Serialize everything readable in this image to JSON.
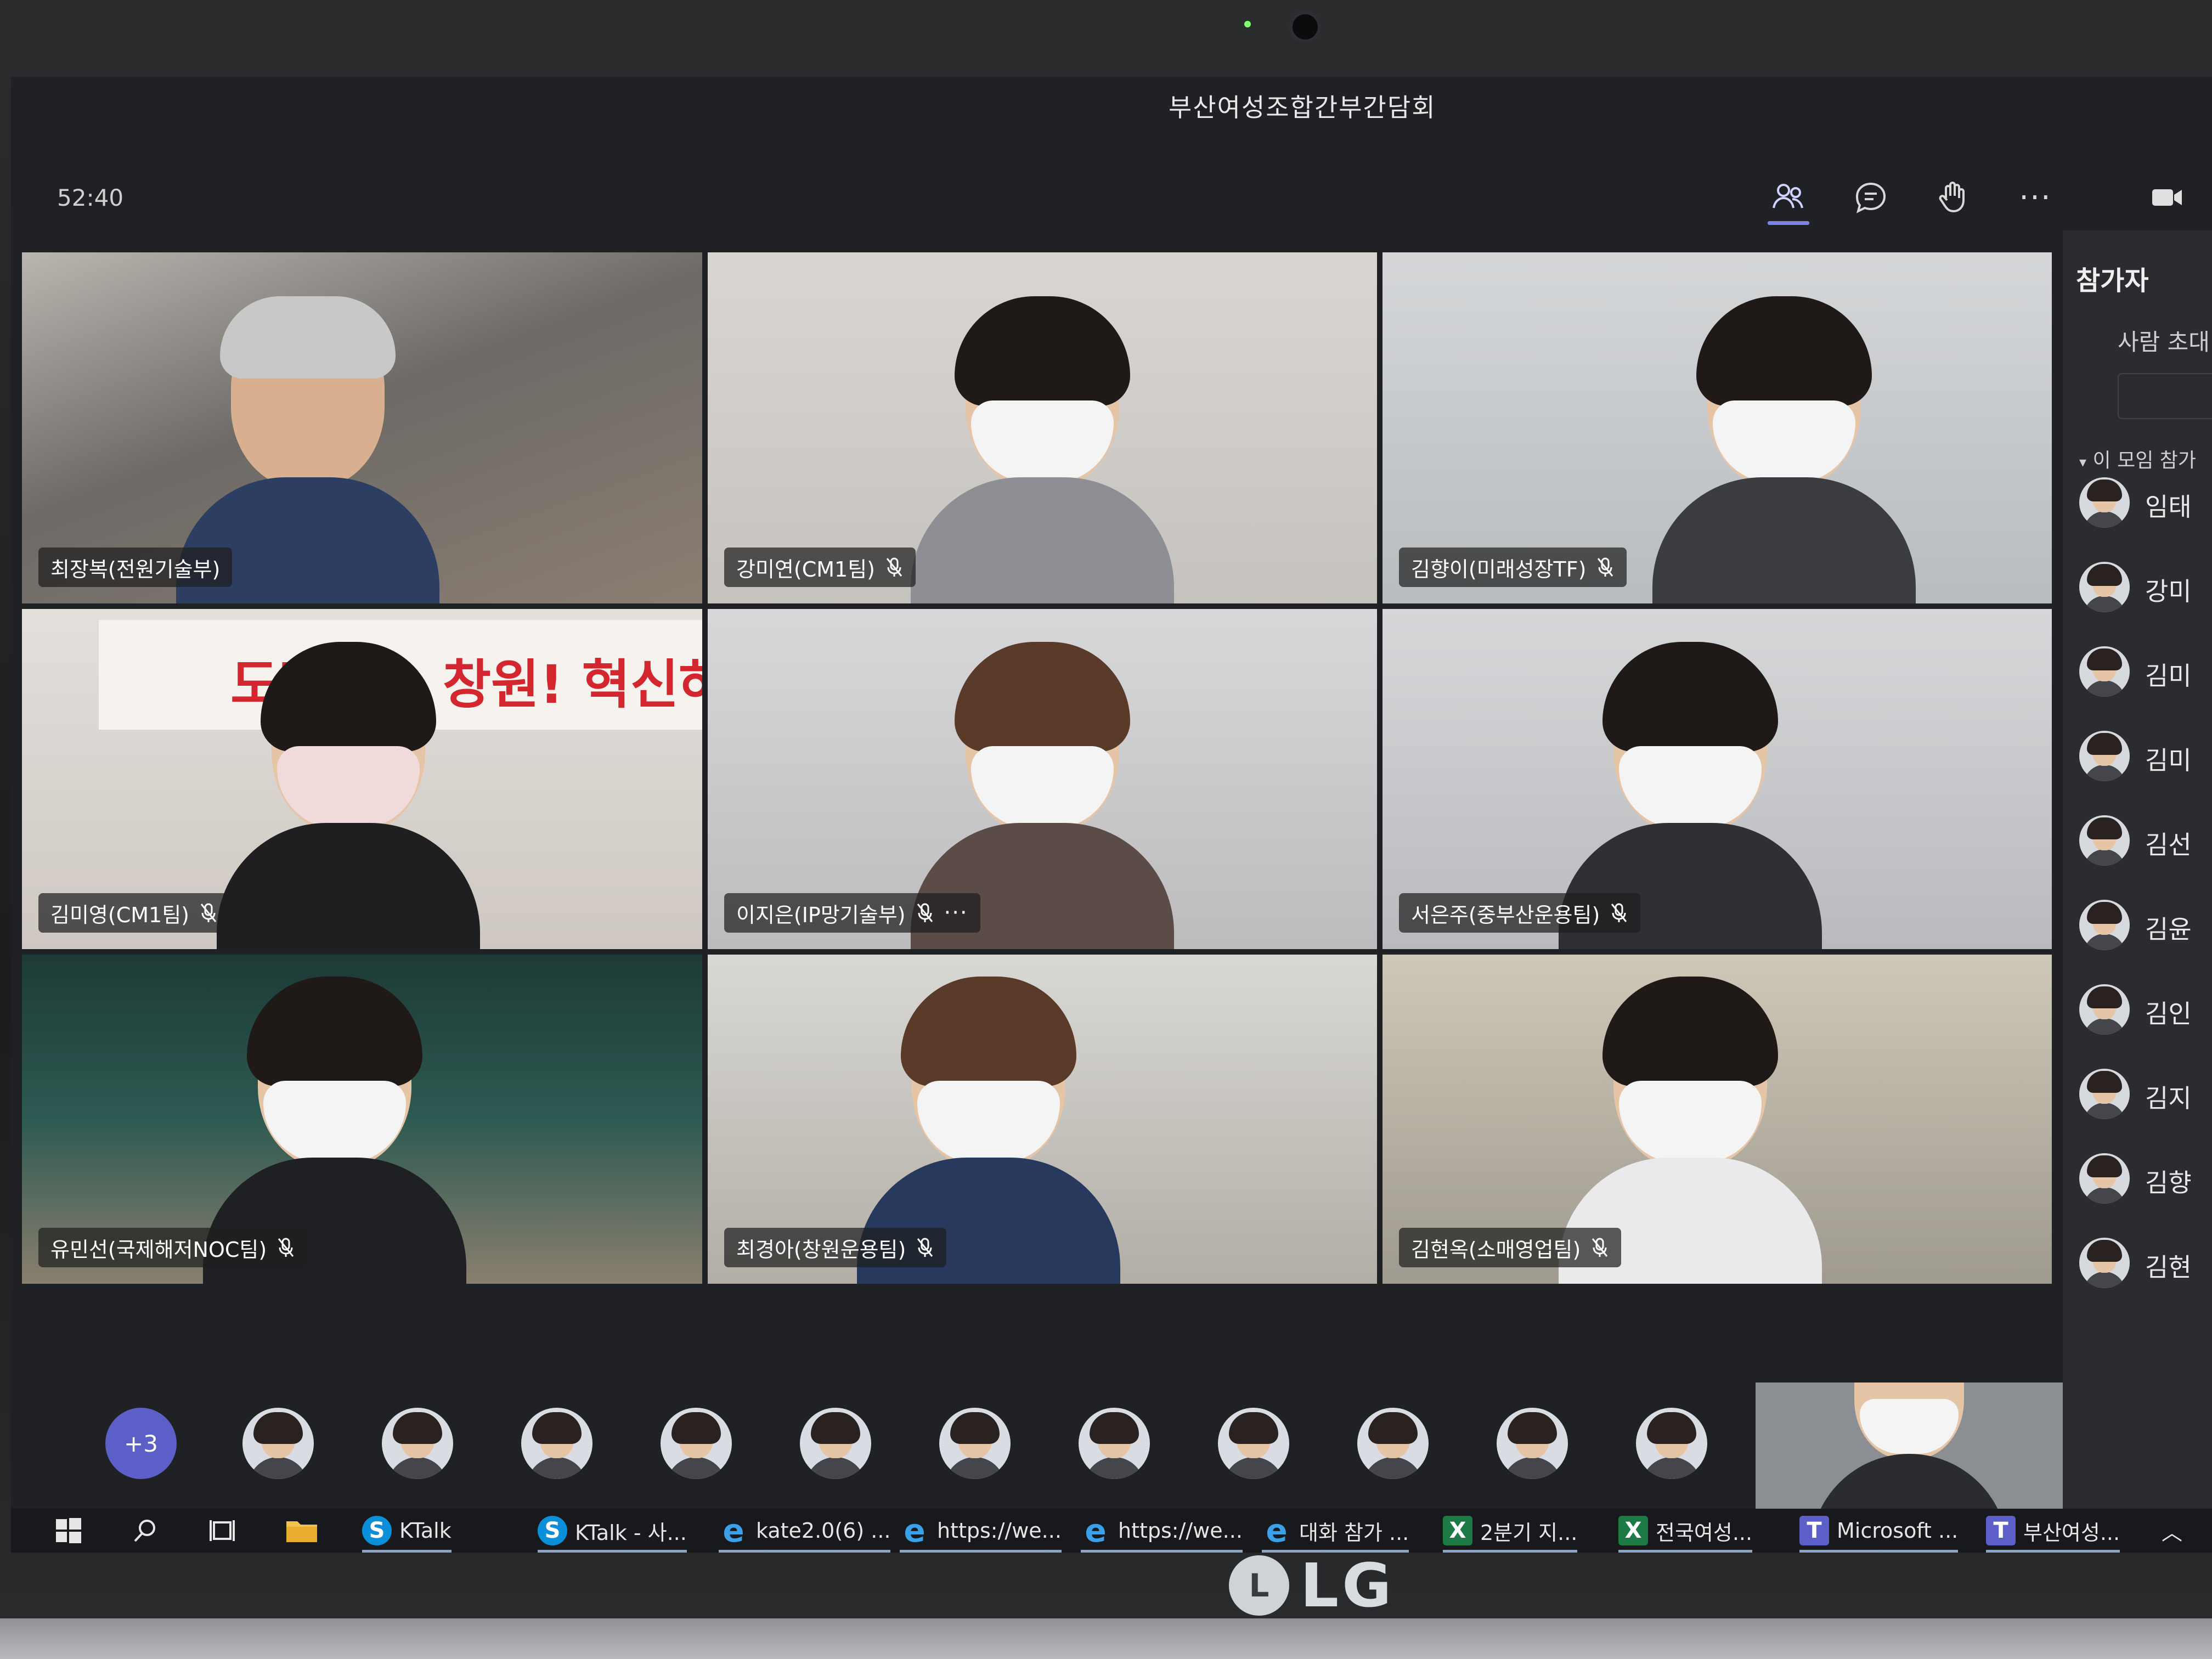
{
  "meeting": {
    "title": "부산여성조합간부간담회",
    "elapsed_time": "52:40"
  },
  "toolbar": {
    "icons": [
      "participants-icon",
      "chat-icon",
      "raise-hand-icon",
      "more-icon",
      "camera-icon"
    ],
    "more_label": "···"
  },
  "tiles": [
    {
      "name": "최장복(전원기술부)",
      "muted": false
    },
    {
      "name": "강미연(CM1팀)",
      "muted": true
    },
    {
      "name": "김향이(미래성장TF)",
      "muted": true
    },
    {
      "name": "김미영(CM1팀)",
      "muted": true,
      "banner": "도전하는 창원! 혁신하라"
    },
    {
      "name": "이지은(IP망기술부)",
      "muted": true,
      "more": "···"
    },
    {
      "name": "서은주(중부산운용팀)",
      "muted": true
    },
    {
      "name": "유민선(국제해저NOC팀)",
      "muted": true
    },
    {
      "name": "최경아(창원운용팀)",
      "muted": true
    },
    {
      "name": "김현옥(소매영업팀)",
      "muted": true
    }
  ],
  "strip": {
    "overflow_count": "+3",
    "avatars": 11
  },
  "participants_panel": {
    "title": "참가자",
    "invite_label": "사람 초대",
    "section_label": "이 모임 참가",
    "items": [
      "임태",
      "강미",
      "김미",
      "김미",
      "김선",
      "김윤",
      "김인",
      "김지",
      "김향",
      "김현"
    ]
  },
  "taskbar": {
    "items": [
      {
        "label": "",
        "icon": "windows-icon"
      },
      {
        "label": "",
        "icon": "search-icon"
      },
      {
        "label": "",
        "icon": "task-view-icon"
      },
      {
        "label": "",
        "icon": "folder-icon"
      },
      {
        "label": "KTalk",
        "icon": "skype-icon"
      },
      {
        "label": "KTalk - 사...",
        "icon": "skype-icon"
      },
      {
        "label": "kate2.0(6) ...",
        "icon": "ie-icon"
      },
      {
        "label": "https://we...",
        "icon": "ie-icon"
      },
      {
        "label": "https://we...",
        "icon": "ie-icon"
      },
      {
        "label": "대화 참가 ...",
        "icon": "ie-icon"
      },
      {
        "label": "2분기 지...",
        "icon": "excel-icon"
      },
      {
        "label": "전국여성...",
        "icon": "excel-icon"
      },
      {
        "label": "Microsoft ...",
        "icon": "teams-icon"
      },
      {
        "label": "부산여성...",
        "icon": "teams-icon"
      }
    ]
  },
  "device": {
    "brand": "LG",
    "brand_mark": "L"
  },
  "colors": {
    "accent": "#7b83eb",
    "badge": "#5b5fc7",
    "banner_red": "#d4262e"
  }
}
